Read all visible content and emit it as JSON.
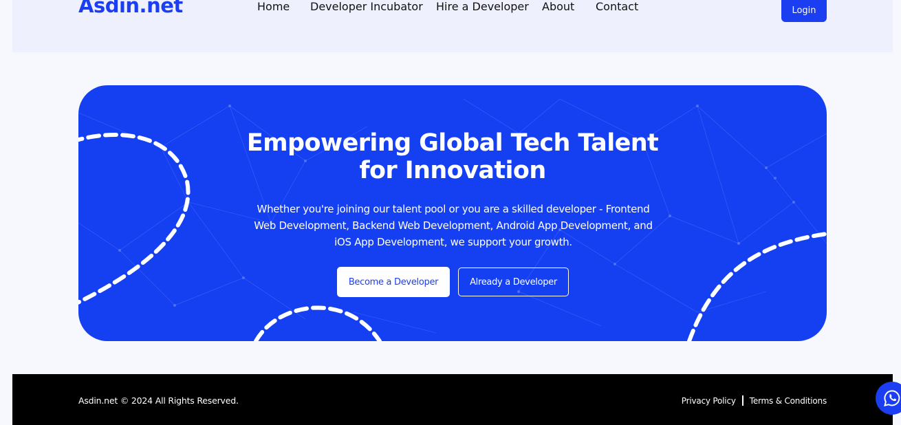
{
  "brand": {
    "logo_text": "Asdin.net"
  },
  "nav": {
    "items": [
      {
        "label": "Home"
      },
      {
        "label": "Developer Incubator"
      },
      {
        "label": "Hire a Developer"
      },
      {
        "label": "About"
      },
      {
        "label": "Contact"
      }
    ],
    "login_label": "Login"
  },
  "hero": {
    "title_line1": "Empowering Global Tech Talent",
    "title_line2": "for Innovation",
    "subtitle": "Whether you're joining our talent pool or you are a skilled developer - Frontend Web Development, Backend Web Development, Android App Development, and iOS App Development, we support your growth.",
    "primary_button": "Become a Developer",
    "secondary_button": "Already a Developer"
  },
  "footer": {
    "copyright": "Asdin.net © 2024 All Rights Reserved.",
    "privacy_label": "Privacy Policy",
    "terms_label": "Terms & Conditions"
  },
  "icons": {
    "chat": "whatsapp-icon"
  },
  "colors": {
    "accent": "#1a3ef0",
    "hero_bg": "#1540f2",
    "footer_bg": "#000000",
    "page_bg": "#f7f8fd"
  }
}
